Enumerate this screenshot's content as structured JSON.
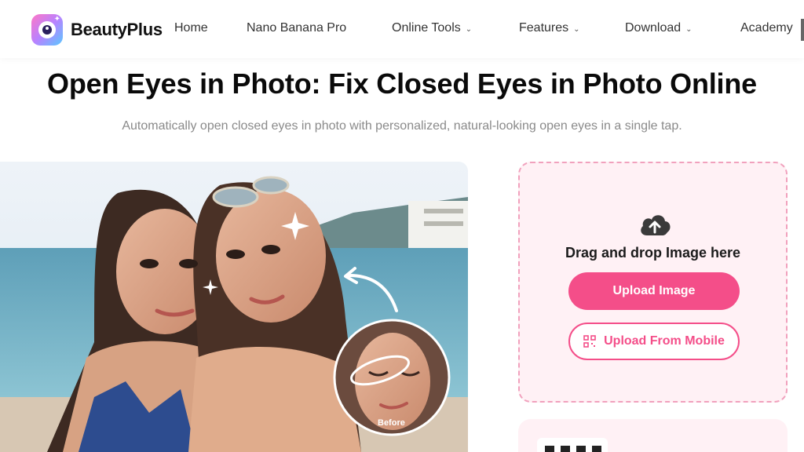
{
  "brand": {
    "name": "BeautyPlus"
  },
  "nav": {
    "home": "Home",
    "nano": "Nano Banana Pro",
    "online_tools": "Online Tools",
    "features": "Features",
    "download": "Download",
    "academy": "Academy"
  },
  "hero": {
    "title": "Open Eyes in Photo: Fix Closed Eyes in Photo Online",
    "subtitle": "Automatically open closed eyes in photo with personalized, natural-looking open eyes in a single tap."
  },
  "photo": {
    "before_label": "Before"
  },
  "upload": {
    "drag_text": "Drag and drop Image here",
    "upload_button": "Upload Image",
    "mobile_button": "Upload From Mobile"
  },
  "colors": {
    "accent": "#f44e89",
    "panel": "#fff1f5",
    "dashed": "#f1a1bd"
  },
  "icons": [
    "logo-icon",
    "chevron-down-icon",
    "cloud-upload-icon",
    "qr-code-icon",
    "sparkle-icon",
    "curved-arrow-icon"
  ]
}
